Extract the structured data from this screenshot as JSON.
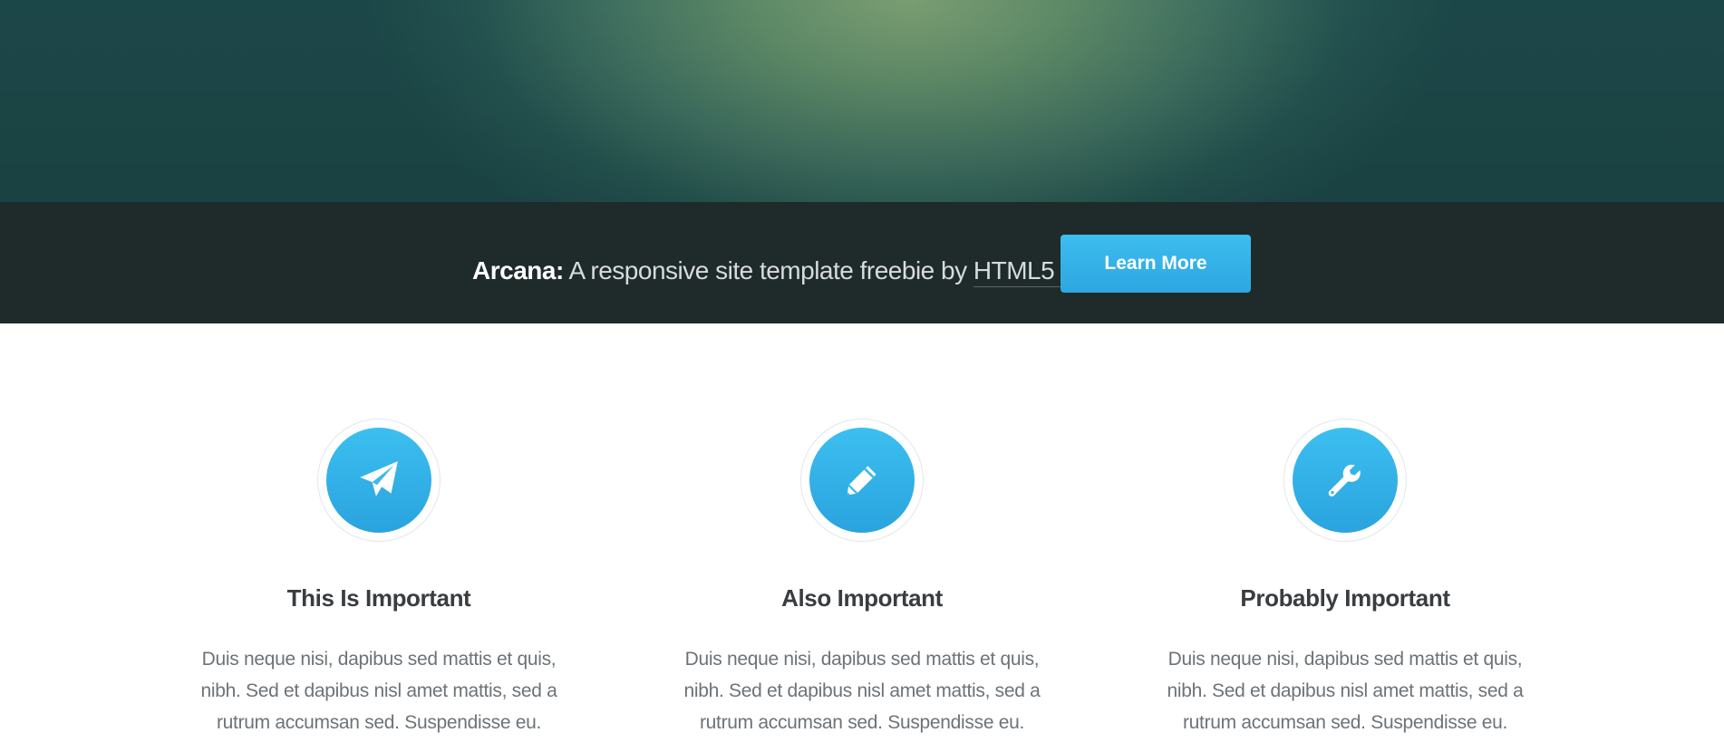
{
  "banner": {
    "brand": "Arcana:",
    "tagline": "A responsive site template freebie by",
    "link_text": "HTML5 UP",
    "button_label": "Learn More"
  },
  "colors": {
    "accent": "#32b1e8",
    "banner_bg": "#1f2a2a",
    "hero_dark": "#1c4748",
    "hero_light": "#7a9d72"
  },
  "features": [
    {
      "icon": "paper-plane-icon",
      "title": "This Is Important",
      "text": "Duis neque nisi, dapibus sed mattis et quis, nibh. Sed et dapibus nisl amet mattis, sed a rutrum accumsan sed. Suspendisse eu."
    },
    {
      "icon": "pencil-icon",
      "title": "Also Important",
      "text": "Duis neque nisi, dapibus sed mattis et quis, nibh. Sed et dapibus nisl amet mattis, sed a rutrum accumsan sed. Suspendisse eu."
    },
    {
      "icon": "wrench-icon",
      "title": "Probably Important",
      "text": "Duis neque nisi, dapibus sed mattis et quis, nibh. Sed et dapibus nisl amet mattis, sed a rutrum accumsan sed. Suspendisse eu."
    }
  ]
}
